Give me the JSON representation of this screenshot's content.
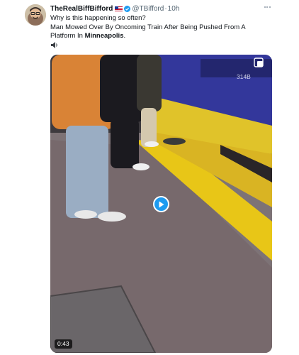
{
  "post": {
    "author": {
      "display_name": "TheRealBiffBifford",
      "handle": "@TBifford",
      "flag_icon": "us-flag-icon",
      "verified_icon": "verified-badge-icon"
    },
    "separator": "·",
    "time": "10h",
    "more_icon": "more-horizontal-icon",
    "text_line1": "Why is this happening so often?",
    "text_line2": "Man Mowed Over By Oncoming Train After Being Pushed From A",
    "text_line3_prefix": "Platform In ",
    "text_line3_bold": "Minneapolis",
    "text_line3_suffix": ".",
    "speaker_icon": "speaker-icon"
  },
  "video": {
    "train_number": "314B",
    "duration": "0:43",
    "play_icon": "play-icon",
    "expand_icon": "expand-icon"
  },
  "colors": {
    "verified": "#1d9bf0",
    "play_button": "#1d9bf0",
    "train_blue": "#33379b",
    "platform_yellow": "#e8c617"
  }
}
